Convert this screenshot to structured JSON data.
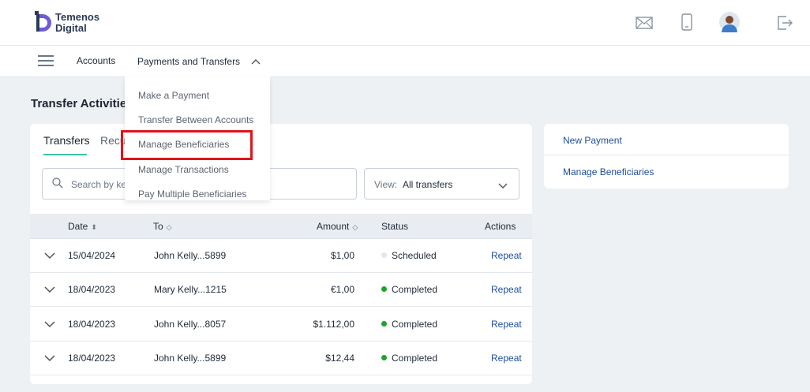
{
  "brand": {
    "line1": "Temenos",
    "line2": "Digital"
  },
  "top_icons": [
    "mail-icon",
    "mobile-icon",
    "avatar",
    "logout-icon"
  ],
  "nav": {
    "accounts": "Accounts",
    "payments": "Payments and Transfers"
  },
  "dropdown": {
    "items": [
      "Make a Payment",
      "Transfer Between Accounts",
      "Manage Beneficiaries",
      "Manage Transactions",
      "Pay Multiple Beneficiaries"
    ],
    "highlighted_index": 2,
    "highlight_color": "#e0141b"
  },
  "page_title": "Transfer Activities",
  "tabs": {
    "active": "Transfers",
    "partial": "Recu"
  },
  "search": {
    "placeholder": "Search by key"
  },
  "view": {
    "label": "View:",
    "value": "All transfers"
  },
  "table": {
    "headers": [
      "Date",
      "To",
      "Amount",
      "Status",
      "Actions"
    ],
    "rows": [
      {
        "date": "15/04/2024",
        "to": "John Kelly...5899",
        "amount": "$1,00",
        "status": "Scheduled",
        "status_color": "#e3e6ea",
        "action": "Repeat"
      },
      {
        "date": "18/04/2023",
        "to": "Mary Kelly...1215",
        "amount": "€1,00",
        "status": "Completed",
        "status_color": "#1fa32b",
        "action": "Repeat"
      },
      {
        "date": "18/04/2023",
        "to": "John Kelly...8057",
        "amount": "$1.112,00",
        "status": "Completed",
        "status_color": "#1fa32b",
        "action": "Repeat"
      },
      {
        "date": "18/04/2023",
        "to": "John Kelly...5899",
        "amount": "$12,44",
        "status": "Completed",
        "status_color": "#1fa32b",
        "action": "Repeat"
      }
    ]
  },
  "side_links": [
    "New Payment",
    "Manage Beneficiaries"
  ],
  "colors": {
    "accent_tab": "#3ec3a5",
    "link": "#1e4e9c"
  }
}
